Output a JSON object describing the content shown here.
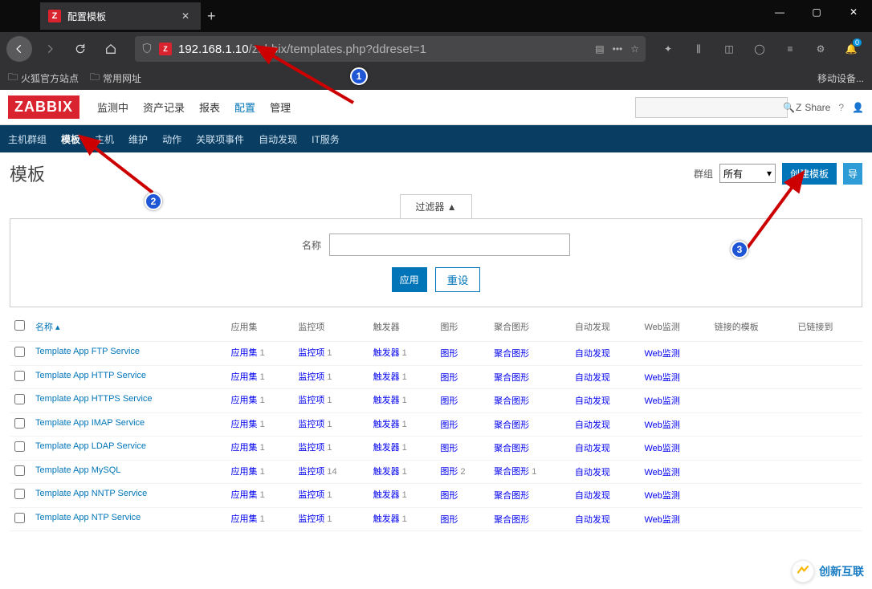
{
  "browser": {
    "tab_title": "配置模板",
    "url_host": "192.168.1.10",
    "url_path": "/zabbix/templates.php?ddreset=1",
    "bookmarks": {
      "b1": "火狐官方站点",
      "b2": "常用网址",
      "right": "移动设备..."
    },
    "notif_count": "0"
  },
  "app": {
    "logo": "ZABBIX",
    "topnav": {
      "n1": "监测中",
      "n2": "资产记录",
      "n3": "报表",
      "n4": "配置",
      "n5": "管理"
    },
    "share": "Share",
    "subnav": {
      "s1": "主机群组",
      "s2": "模板",
      "s3": "主机",
      "s4": "维护",
      "s5": "动作",
      "s6": "关联项事件",
      "s7": "自动发现",
      "s8": "IT服务"
    },
    "page_title": "模板",
    "group_label": "群组",
    "group_value": "所有",
    "create_btn": "创建模板",
    "import_btn": "导",
    "filter_tab": "过滤器 ▲",
    "filter_name_label": "名称",
    "filter_apply": "应用",
    "filter_reset": "重设",
    "cols": {
      "name": "名称",
      "apps": "应用集",
      "items": "监控项",
      "triggers": "触发器",
      "graphs": "图形",
      "screens": "聚合图形",
      "discovery": "自动发现",
      "web": "Web监测",
      "linked": "链接的模板",
      "linkedto": "已链接到"
    },
    "cell": {
      "apps": "应用集",
      "items": "监控项",
      "triggers": "触发器",
      "graphs": "图形",
      "screens": "聚合图形",
      "cgraphs": "聚合图形",
      "discovery": "自动发现",
      "web": "Web监测"
    },
    "rows": [
      {
        "name": "Template App FTP Service",
        "apps": 1,
        "items": 1,
        "triggers": 1,
        "graphs": "",
        "screens": "",
        "discovery": "",
        "web": ""
      },
      {
        "name": "Template App HTTP Service",
        "apps": 1,
        "items": 1,
        "triggers": 1
      },
      {
        "name": "Template App HTTPS Service",
        "apps": 1,
        "items": 1,
        "triggers": 1
      },
      {
        "name": "Template App IMAP Service",
        "apps": 1,
        "items": 1,
        "triggers": 1
      },
      {
        "name": "Template App LDAP Service",
        "apps": 1,
        "items": 1,
        "triggers": 1
      },
      {
        "name": "Template App MySQL",
        "apps": 1,
        "items": 14,
        "triggers": 1,
        "graphs": 2,
        "screens": 1
      },
      {
        "name": "Template App NNTP Service",
        "apps": 1,
        "items": 1,
        "triggers": 1
      },
      {
        "name": "Template App NTP Service",
        "apps": 1,
        "items": 1,
        "triggers": 1
      }
    ]
  },
  "watermark": "创新互联"
}
